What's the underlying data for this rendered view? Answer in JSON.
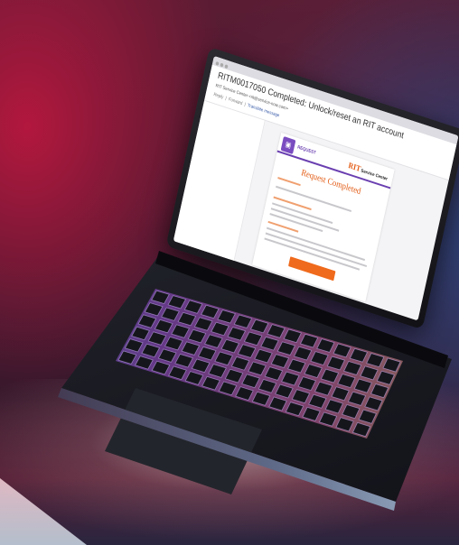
{
  "scene": {
    "colors": {
      "backdrop_red": "#b3173e",
      "backdrop_blue": "#2e3f72",
      "rit_orange": "#e35b14",
      "request_purple": "#7a4cc0"
    }
  },
  "email": {
    "subject": "RITM0017050 Completed: Unlock/reset an RIT account",
    "sender": "RIT Service Center <rit@service-now.com>",
    "toolbar_reply": "Reply",
    "toolbar_forward": "Forward",
    "toolbar_link": "Translate message",
    "request_label": "REQUEST",
    "brand_main": "RIT",
    "brand_sub": "Service Center",
    "heading": "Request Completed"
  }
}
